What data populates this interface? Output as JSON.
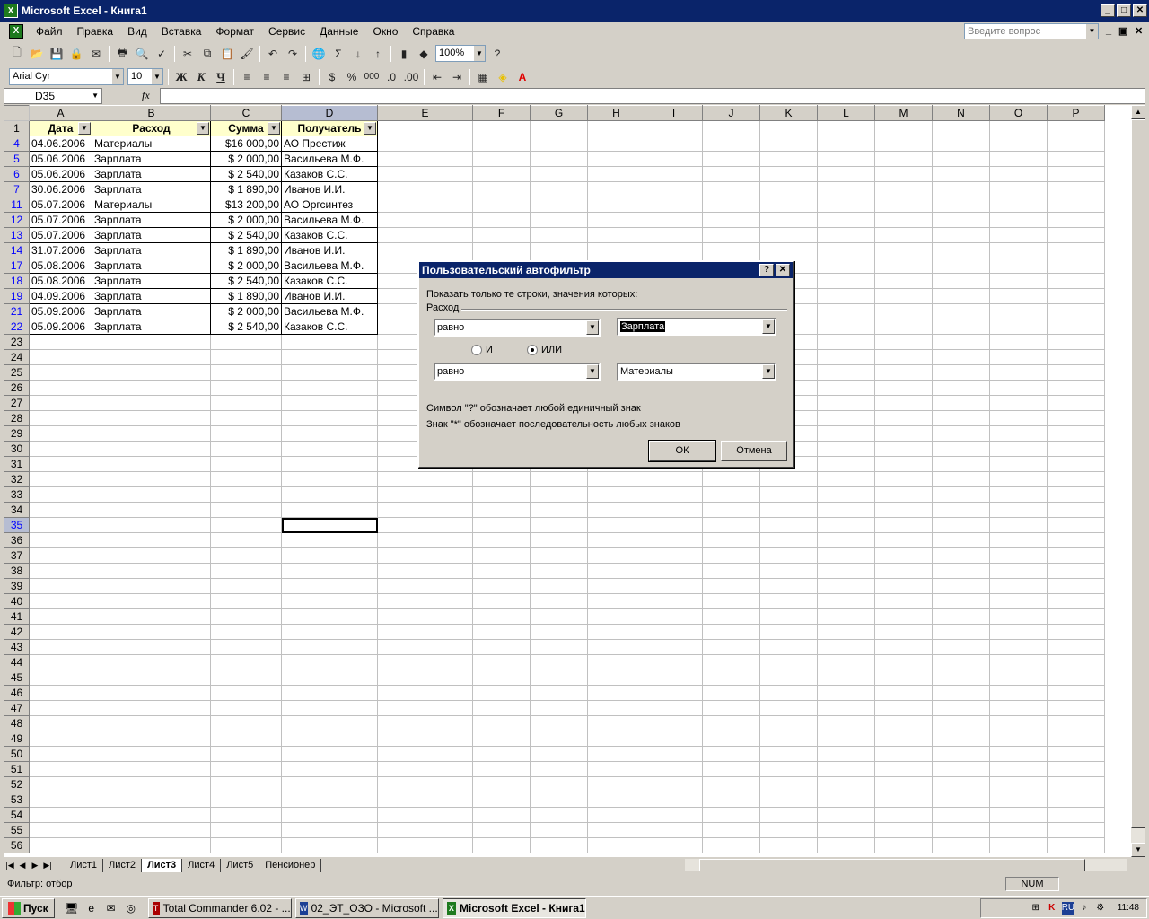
{
  "window": {
    "title": "Microsoft Excel - Книга1"
  },
  "menu": {
    "items": [
      "Файл",
      "Правка",
      "Вид",
      "Вставка",
      "Формат",
      "Сервис",
      "Данные",
      "Окно",
      "Справка"
    ],
    "help_placeholder": "Введите вопрос"
  },
  "toolbar": {
    "zoom": "100%",
    "font_name": "Arial Cyr",
    "font_size": "10",
    "bold": "Ж",
    "italic": "К",
    "underline": "Ч",
    "percent": "%",
    "thousands": "000",
    "sum": "Σ"
  },
  "formula_bar": {
    "cell_ref": "D35",
    "fx": "fx",
    "formula": ""
  },
  "sheet": {
    "columns": [
      "A",
      "B",
      "C",
      "D",
      "E",
      "F",
      "G",
      "H",
      "I",
      "J",
      "K",
      "L",
      "M",
      "N",
      "O",
      "P"
    ],
    "headers": [
      "Дата",
      "Расход",
      "Сумма",
      "Получатель"
    ],
    "rows": [
      {
        "n": "4",
        "date": "04.06.2006",
        "exp": "Материалы",
        "sum": "$16 000,00",
        "rcp": "АО Престиж"
      },
      {
        "n": "5",
        "date": "05.06.2006",
        "exp": "Зарплата",
        "sum": "$ 2 000,00",
        "rcp": "Васильева М.Ф."
      },
      {
        "n": "6",
        "date": "05.06.2006",
        "exp": "Зарплата",
        "sum": "$ 2 540,00",
        "rcp": "Казаков С.С."
      },
      {
        "n": "7",
        "date": "30.06.2006",
        "exp": "Зарплата",
        "sum": "$ 1 890,00",
        "rcp": "Иванов И.И."
      },
      {
        "n": "11",
        "date": "05.07.2006",
        "exp": "Материалы",
        "sum": "$13 200,00",
        "rcp": "АО Оргсинтез"
      },
      {
        "n": "12",
        "date": "05.07.2006",
        "exp": "Зарплата",
        "sum": "$ 2 000,00",
        "rcp": "Васильева М.Ф."
      },
      {
        "n": "13",
        "date": "05.07.2006",
        "exp": "Зарплата",
        "sum": "$ 2 540,00",
        "rcp": "Казаков С.С."
      },
      {
        "n": "14",
        "date": "31.07.2006",
        "exp": "Зарплата",
        "sum": "$ 1 890,00",
        "rcp": "Иванов И.И."
      },
      {
        "n": "17",
        "date": "05.08.2006",
        "exp": "Зарплата",
        "sum": "$ 2 000,00",
        "rcp": "Васильева М.Ф."
      },
      {
        "n": "18",
        "date": "05.08.2006",
        "exp": "Зарплата",
        "sum": "$ 2 540,00",
        "rcp": "Казаков С.С."
      },
      {
        "n": "19",
        "date": "04.09.2006",
        "exp": "Зарплата",
        "sum": "$ 1 890,00",
        "rcp": "Иванов И.И."
      },
      {
        "n": "21",
        "date": "05.09.2006",
        "exp": "Зарплата",
        "sum": "$ 2 000,00",
        "rcp": "Васильева М.Ф."
      },
      {
        "n": "22",
        "date": "05.09.2006",
        "exp": "Зарплата",
        "sum": "$ 2 540,00",
        "rcp": "Казаков С.С."
      }
    ],
    "empty_rows": [
      "23",
      "24",
      "25",
      "26",
      "27",
      "28",
      "29",
      "30",
      "31",
      "32",
      "33",
      "34",
      "35",
      "36",
      "37",
      "38",
      "39",
      "40",
      "41",
      "42",
      "43",
      "44",
      "45",
      "46",
      "47",
      "48",
      "49",
      "50",
      "51",
      "52",
      "53",
      "54",
      "55",
      "56"
    ],
    "active_row": "35",
    "tabs": [
      "Лист1",
      "Лист2",
      "Лист3",
      "Лист4",
      "Лист5",
      "Пенсионер"
    ],
    "active_tab": "Лист3"
  },
  "dialog": {
    "title": "Пользовательский автофильтр",
    "prompt": "Показать только те строки, значения которых:",
    "field": "Расход",
    "op1": "равно",
    "val1": "Зарплата",
    "and_label": "И",
    "or_label": "ИЛИ",
    "op2": "равно",
    "val2": "Материалы",
    "hint1": "Символ \"?\" обозначает любой единичный знак",
    "hint2": "Знак \"*\" обозначает последовательность любых знаков",
    "ok": "ОК",
    "cancel": "Отмена"
  },
  "status": {
    "text": "Фильтр: отбор",
    "num": "NUM"
  },
  "taskbar": {
    "start": "Пуск",
    "tasks": [
      "Total Commander 6.02 - ...",
      "02_ЭТ_ОЗО - Microsoft ...",
      "Microsoft Excel - Книга1"
    ],
    "lang": "RU",
    "clock": "11:48"
  }
}
